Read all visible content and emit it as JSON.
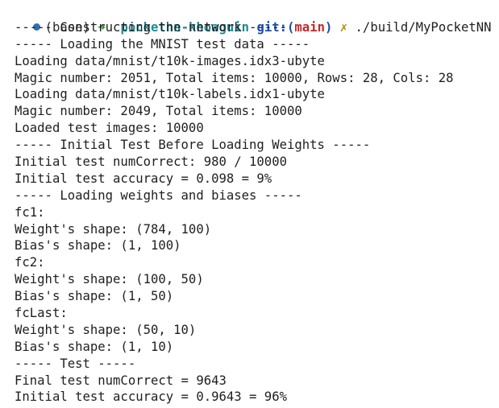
{
  "prompt": {
    "env": "(base)",
    "arrow": "➜",
    "dir": "pocketnn-khoaguin",
    "git_label": "git:(",
    "branch": "main",
    "git_close": ")",
    "dirty_mark": "✗",
    "command": "./build/MyPocketNN"
  },
  "output": [
    "----- Constructing the network -----",
    "----- Loading the MNIST test data -----",
    "Loading data/mnist/t10k-images.idx3-ubyte",
    "Magic number: 2051, Total items: 10000, Rows: 28, Cols: 28",
    "Loading data/mnist/t10k-labels.idx1-ubyte",
    "Magic number: 2049, Total items: 10000",
    "Loaded test images: 10000",
    "----- Initial Test Before Loading Weights -----",
    "Initial test numCorrect: 980 / 10000",
    "Initial test accuracy = 0.098 = 9%",
    "----- Loading weights and biases -----",
    "fc1:",
    "Weight's shape: (784, 100)",
    "Bias's shape: (1, 100)",
    "fc2:",
    "Weight's shape: (100, 50)",
    "Bias's shape: (1, 50)",
    "fcLast:",
    "Weight's shape: (50, 10)",
    "Bias's shape: (1, 10)",
    "----- Test -----",
    "Final test numCorrect = 9643",
    "Initial test accuracy = 0.9643 = 96%"
  ],
  "colors": {
    "prompt_dot": "#2f6fb6",
    "arrow": "#13a10e",
    "dir": "#1a8a9a",
    "git": "#1c4fa8",
    "branch": "#c62828",
    "dirty": "#b58900"
  }
}
